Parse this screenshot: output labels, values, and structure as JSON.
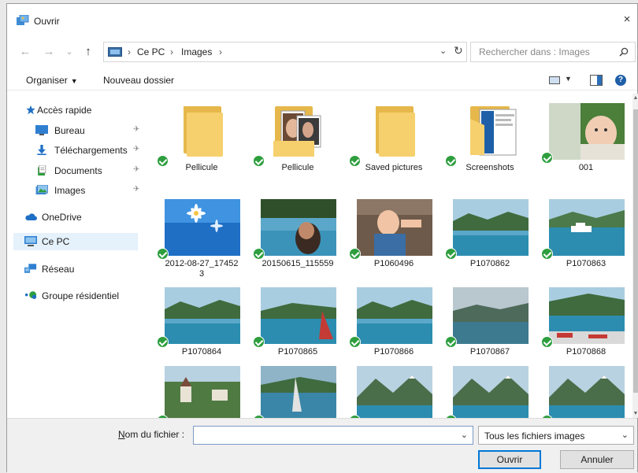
{
  "window": {
    "title": "Ouvrir",
    "close_glyph": "×"
  },
  "nav": {
    "back_glyph": "←",
    "forward_glyph": "→",
    "recent_glyph": "⌄",
    "up_glyph": "↑"
  },
  "address": {
    "separator": "›",
    "crumbs": [
      "Ce PC",
      "Images"
    ],
    "dropdown_glyph": "⌄",
    "refresh_glyph": "↻"
  },
  "search": {
    "placeholder": "Rechercher dans : Images"
  },
  "toolbar": {
    "organize_label": "Organiser",
    "organize_caret": "▼",
    "new_folder_label": "Nouveau dossier",
    "view_caret": "▼",
    "help_glyph": "?"
  },
  "sidebar": {
    "items": [
      {
        "label": "Accès rapide",
        "icon": "star-icon"
      },
      {
        "label": "Bureau",
        "icon": "desktop-icon",
        "pinned": true
      },
      {
        "label": "Téléchargements",
        "icon": "download-icon",
        "pinned": true
      },
      {
        "label": "Documents",
        "icon": "documents-icon",
        "pinned": true
      },
      {
        "label": "Images",
        "icon": "pictures-icon",
        "pinned": true
      },
      {
        "label": "OneDrive",
        "icon": "cloud-icon"
      },
      {
        "label": "Ce PC",
        "icon": "computer-icon",
        "selected": true
      },
      {
        "label": "Réseau",
        "icon": "network-icon"
      },
      {
        "label": "Groupe résidentiel",
        "icon": "homegroup-icon"
      }
    ],
    "pin_glyph": "✈"
  },
  "files": [
    {
      "label": "Pellicule",
      "kind": "folder"
    },
    {
      "label": "Pellicule",
      "kind": "folder-photos"
    },
    {
      "label": "Saved pictures",
      "kind": "folder"
    },
    {
      "label": "Screenshots",
      "kind": "folder-screenshot"
    },
    {
      "label": "001",
      "kind": "photo-baby"
    },
    {
      "label": "2012-08-27_17452\n3",
      "kind": "photo-daisy"
    },
    {
      "label": "20150615_115559",
      "kind": "photo-pool"
    },
    {
      "label": "P1060496",
      "kind": "photo-child"
    },
    {
      "label": "P1070862",
      "kind": "photo-lake"
    },
    {
      "label": "P1070863",
      "kind": "photo-lake-boat"
    },
    {
      "label": "P1070864",
      "kind": "photo-lake"
    },
    {
      "label": "P1070865",
      "kind": "photo-lake-sail"
    },
    {
      "label": "P1070866",
      "kind": "photo-lake"
    },
    {
      "label": "P1070867",
      "kind": "photo-lake-dark"
    },
    {
      "label": "P1070868",
      "kind": "photo-lake-red"
    },
    {
      "label": "",
      "kind": "photo-village"
    },
    {
      "label": "",
      "kind": "photo-windsurf"
    },
    {
      "label": "",
      "kind": "photo-mountain"
    },
    {
      "label": "",
      "kind": "photo-mountain"
    },
    {
      "label": "",
      "kind": "photo-mountain"
    }
  ],
  "bottom": {
    "filename_label_accel": "N",
    "filename_label_rest": "om du fichier :",
    "filename_value": "",
    "filename_dropdown_glyph": "⌄",
    "filetype_label": "Tous les fichiers images",
    "filetype_dropdown_glyph": "⌄",
    "open_label": "Ouvrir",
    "cancel_label": "Annuler"
  },
  "colors": {
    "accent": "#0078d7",
    "check_badge": "#2e9e3e",
    "folder": "#f6d06d",
    "selection": "#e5f1fb"
  }
}
